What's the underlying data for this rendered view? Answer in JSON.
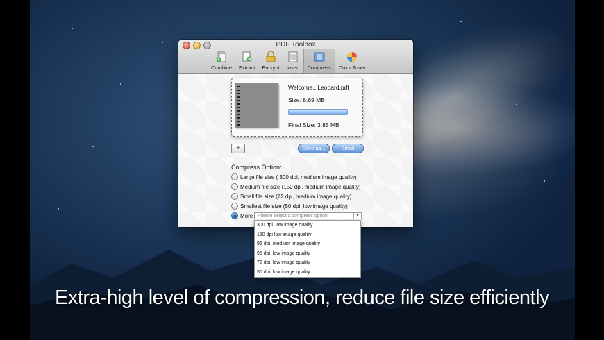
{
  "window": {
    "title": "PDF Toolbox"
  },
  "toolbar": {
    "items": [
      {
        "label": "Combine",
        "icon": "combine-icon"
      },
      {
        "label": "Extract",
        "icon": "extract-icon"
      },
      {
        "label": "Encrypt",
        "icon": "encrypt-icon"
      },
      {
        "label": "Insert",
        "icon": "insert-icon"
      },
      {
        "label": "Compress",
        "icon": "compress-icon",
        "active": true
      },
      {
        "label": "Color Tuner",
        "icon": "color-tuner-icon"
      }
    ]
  },
  "file": {
    "name": "Welcome...Leopard.pdf",
    "size": "Size: 8.69 MB",
    "final_size": "Final Size: 3.85 MB",
    "progress": 1.0
  },
  "buttons": {
    "add": "+",
    "save_as": "Save as...",
    "email": "Email"
  },
  "compress": {
    "title": "Compress Option:",
    "options": [
      "Large file size ( 300 dpi, medium image quality)",
      "Medium file size (150 dpi, medium image quality)",
      "Small file size (72 dpi, medium image quality)",
      "Smallest file size (50 dpi, low image quality)",
      "More"
    ],
    "selected_index": 4,
    "select_placeholder": "Please select a compress option",
    "dropdown": [
      "300 dpi, low image quality",
      "150 dpi low image quality",
      "96 dpi, medium image quality",
      "96 dpi, low image quality",
      "72 dpi, low image quality",
      "50 dpi, low image quality"
    ]
  },
  "caption": "Extra-high level of compression, reduce file size efficiently",
  "colors": {
    "accent": "#5b93d8",
    "window_bg": "#ececec"
  }
}
